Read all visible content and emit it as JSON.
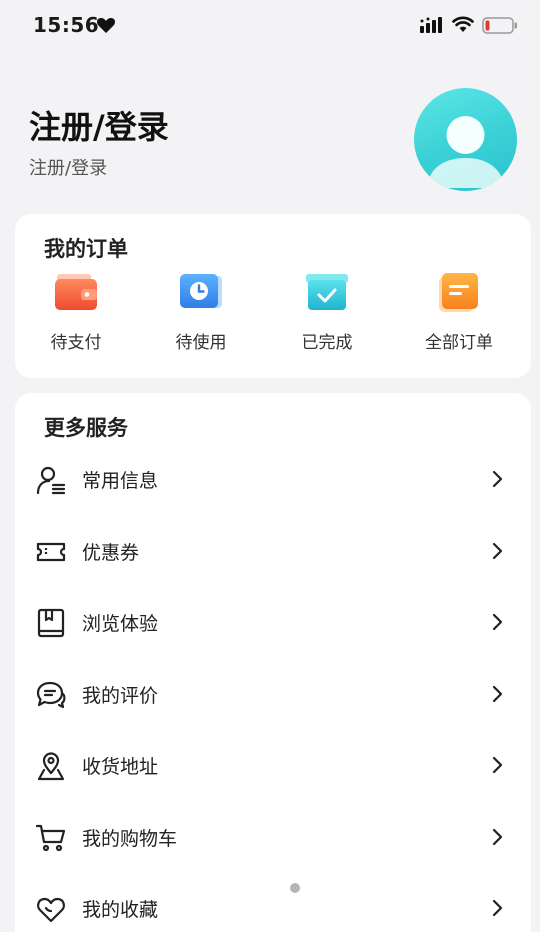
{
  "status_bar": {
    "time": "15:56"
  },
  "profile": {
    "title": "注册/登录",
    "subtitle": "注册/登录"
  },
  "orders": {
    "title": "我的订单",
    "items": [
      {
        "label": "待支付",
        "icon": "wallet-icon"
      },
      {
        "label": "待使用",
        "icon": "clock-icon"
      },
      {
        "label": "已完成",
        "icon": "check-box-icon"
      },
      {
        "label": "全部订单",
        "icon": "orders-list-icon"
      }
    ]
  },
  "services": {
    "title": "更多服务",
    "items": [
      {
        "label": "常用信息",
        "icon": "user-info-icon"
      },
      {
        "label": "优惠券",
        "icon": "coupon-icon"
      },
      {
        "label": "浏览体验",
        "icon": "bookmark-book-icon"
      },
      {
        "label": "我的评价",
        "icon": "comment-icon"
      },
      {
        "label": "收货地址",
        "icon": "location-icon"
      },
      {
        "label": "我的购物车",
        "icon": "cart-icon"
      },
      {
        "label": "我的收藏",
        "icon": "heart-favorite-icon"
      }
    ]
  },
  "colors": {
    "background": "#f3f3f5",
    "card": "#ffffff",
    "avatar": "#39d0d6",
    "wallet": "#f25b3a",
    "clock": "#3a8ee8",
    "check": "#2cc1d6",
    "orders": "#f7941d"
  }
}
